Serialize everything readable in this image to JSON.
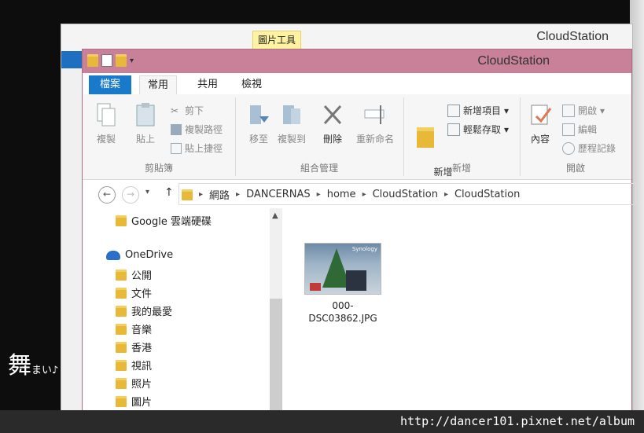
{
  "back_window": {
    "context_tab": "圖片工具",
    "title": "CloudStation"
  },
  "window": {
    "title": "CloudStation"
  },
  "tabs": [
    "檔案",
    "常用",
    "共用",
    "檢視"
  ],
  "ribbon": {
    "clipboard": {
      "copy": "複製",
      "paste": "貼上",
      "cut": "剪下",
      "copy_path": "複製路徑",
      "paste_shortcut": "貼上捷徑",
      "label": "剪貼簿"
    },
    "organize": {
      "move_to": "移至",
      "copy_to": "複製到",
      "delete": "刪除",
      "rename": "重新命名",
      "label": "組合管理"
    },
    "new": {
      "new_folder": "新增\n資料夾",
      "new_item": "新增項目",
      "easy_access": "輕鬆存取",
      "label": "新增"
    },
    "open": {
      "properties": "內容",
      "open": "開啟",
      "edit": "編輯",
      "history": "歷程記錄",
      "label": "開啟"
    }
  },
  "address": {
    "crumbs": [
      "網路",
      "DANCERNAS",
      "home",
      "CloudStation",
      "CloudStation"
    ]
  },
  "nav": {
    "google_drive": "Google 雲端硬碟",
    "onedrive": "OneDrive",
    "folders": [
      "公開",
      "文件",
      "我的最愛",
      "音樂",
      "香港",
      "視訊",
      "照片",
      "圖片"
    ]
  },
  "files": [
    {
      "name": "000-DSC03862.JPG",
      "thumb_label": "Synology"
    }
  ],
  "watermark": {
    "url": "http://dancer101.pixnet.net/album"
  }
}
